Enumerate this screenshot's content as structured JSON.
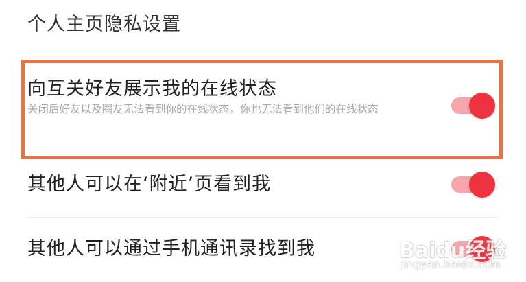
{
  "section": {
    "title": "个人主页隐私设置"
  },
  "settings": [
    {
      "title": "向互关好友展示我的在线状态",
      "description": "关闭后好友以及圈友无法看到你的在线状态，你也无法看到他们的在线状态",
      "enabled": true
    },
    {
      "title": "其他人可以在‘附近’页看到我",
      "enabled": true
    },
    {
      "title": "其他人可以通过手机通讯录找到我",
      "enabled": true
    }
  ],
  "colors": {
    "toggle_on_knob": "#ee3340",
    "toggle_on_track": "#f6a6aa",
    "highlight_border": "#f07040"
  },
  "watermark": {
    "brand": "Baidu经验",
    "url": "jingyan.baidu.com"
  }
}
